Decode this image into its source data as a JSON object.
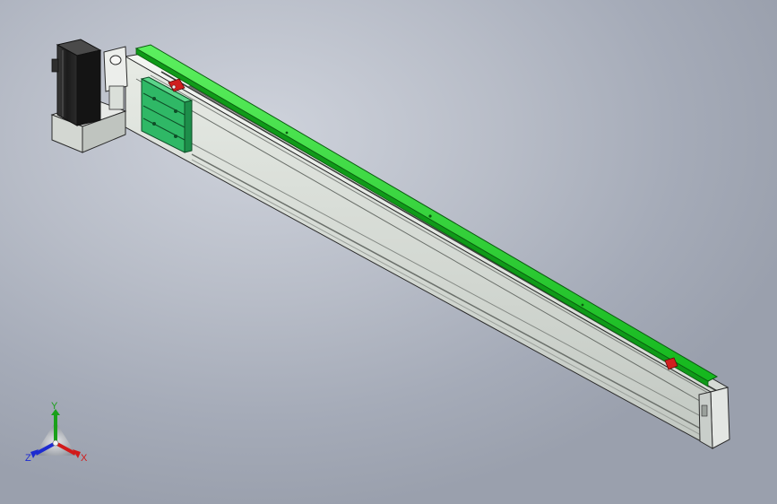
{
  "viewport": {
    "name": "3D model view",
    "background_colors": [
      "#cfd3dc",
      "#b7bcc7",
      "#9aa0ad"
    ]
  },
  "model": {
    "motor_color": "#1e1e1e",
    "rail_color": "#1fd62a",
    "profile_color": "#dfe4dd",
    "carriage_color": "#32c36a",
    "stop_color": "#cf1f1f"
  },
  "triad": {
    "x_label": "X",
    "y_label": "Y",
    "z_label": "Z",
    "x_color": "#d21a1a",
    "y_color": "#1aa01a",
    "z_color": "#1d2bd0"
  }
}
